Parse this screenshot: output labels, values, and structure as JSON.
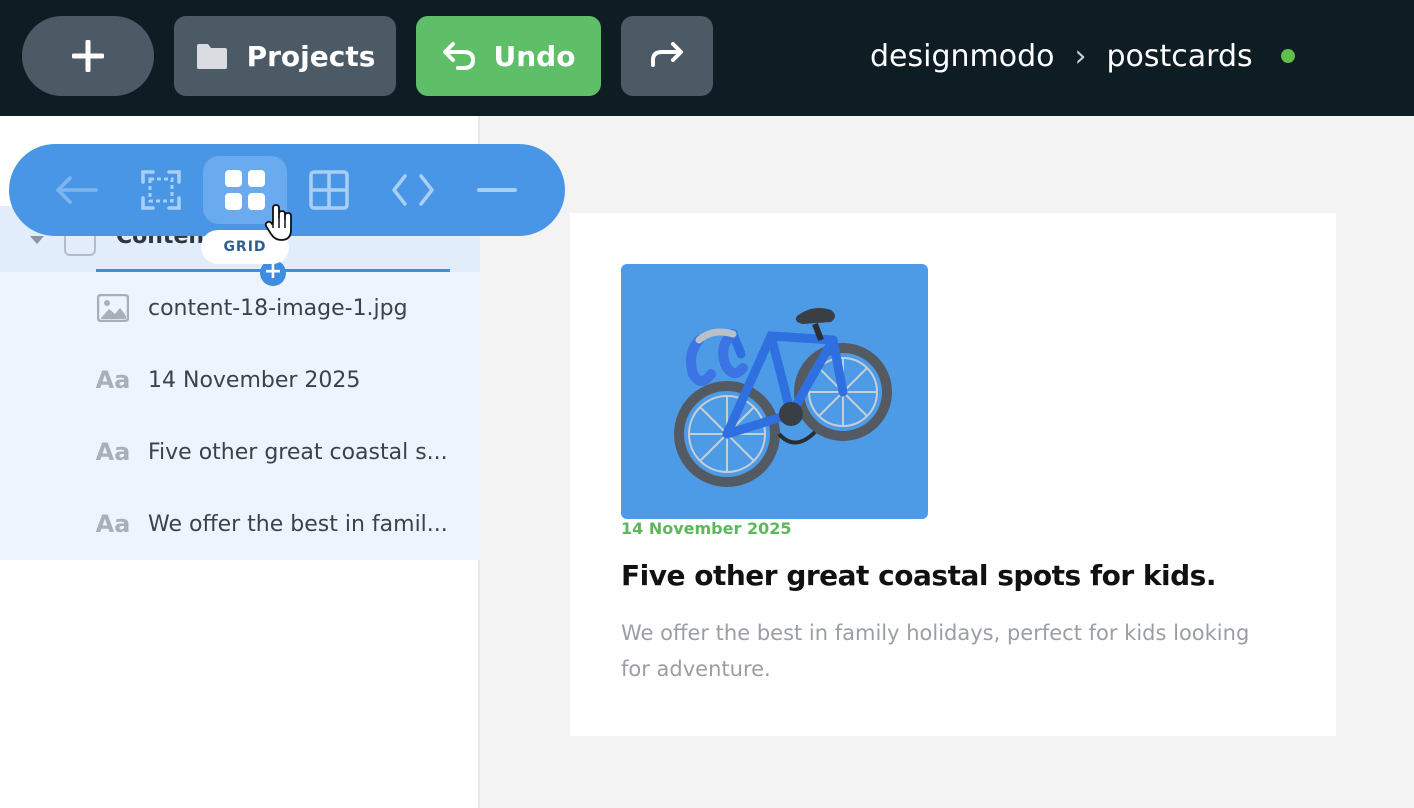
{
  "topbar": {
    "add_icon": "plus-icon",
    "projects_label": "Projects",
    "projects_icon": "folder-icon",
    "undo_label": "Undo",
    "undo_icon": "undo-icon",
    "redo_icon": "redo-icon",
    "breadcrumb": {
      "workspace": "designmodo",
      "separator": "›",
      "project": "postcards"
    },
    "status_color": "#5fbf4a"
  },
  "toolbar": {
    "items": [
      "back-arrow-icon",
      "select-frame-icon",
      "grid-icon",
      "layout-table-icon",
      "code-icon",
      "minus-icon"
    ],
    "active": "grid-icon",
    "tooltip": "GRID"
  },
  "layers": {
    "parent_label": "Content",
    "items": [
      {
        "icon": "image-icon",
        "label": "content-18-image-1.jpg"
      },
      {
        "icon": "text-icon",
        "glyph": "Aa",
        "label": "14 November 2025"
      },
      {
        "icon": "text-icon",
        "glyph": "Aa",
        "label": "Five other great coastal s..."
      },
      {
        "icon": "text-icon",
        "glyph": "Aa",
        "label": "We offer the best in famil..."
      }
    ]
  },
  "card": {
    "date": "14 November 2025",
    "title": "Five other great coastal spots for kids.",
    "text": "We offer the best in family holidays, perfect for kids looking for adventure.",
    "image_alt": "bicycle-image",
    "accent": "#5cb85c"
  }
}
